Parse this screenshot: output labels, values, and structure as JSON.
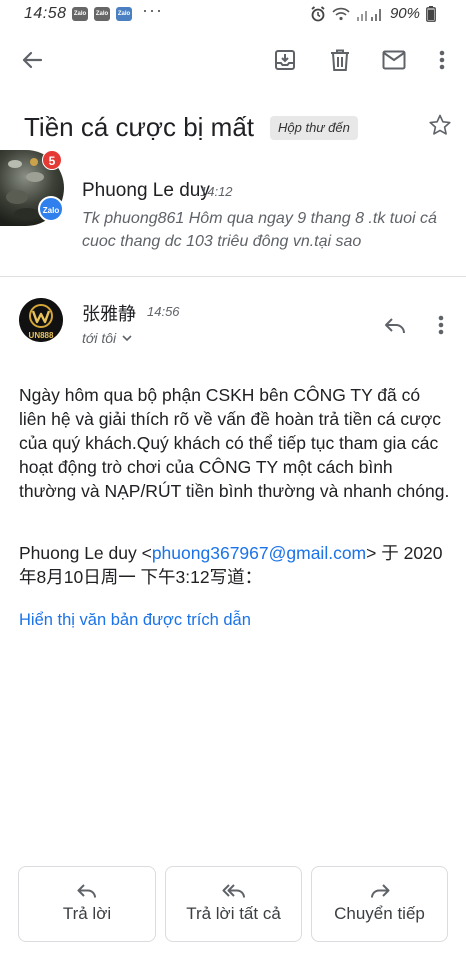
{
  "status_bar": {
    "time": "14:58",
    "app_icons": [
      "Zalo",
      "Zalo",
      "Zalo"
    ],
    "more": "···",
    "battery": "90%"
  },
  "toolbar": {
    "icons": [
      "back-arrow-icon",
      "archive-icon",
      "delete-icon",
      "mark-unread-icon",
      "more-vert-icon"
    ]
  },
  "thread": {
    "subject": "Tiền cá cược bị mất",
    "label": "Hộp thư đến"
  },
  "collapsed_message": {
    "sender": "Phuong Le duy",
    "time": "14:12",
    "badge_count": "5",
    "badge_app": "Zalo",
    "snippet": "Tk phuong861 Hôm qua ngay 9 thang 8 .tk tuoi cá cuoc thang dc 103 triêu đông vn.tại sao"
  },
  "open_message": {
    "sender": "张雅静",
    "time": "14:56",
    "recipient": "tới tôi",
    "avatar_text": "UN888",
    "body": "Ngày hôm qua bộ phận CSKH bên CÔNG TY đã có liên hệ và giải thích rõ về vấn đề hoàn trả tiền cá cược của quý khách.Quý khách có thể tiếp tục tham gia các hoạt động trò chơi của CÔNG TY một cách bình thường và NẠP/RÚT tiền bình thường và nhanh chóng.",
    "quote_prefix": "Phuong Le duy <",
    "quote_email": "phuong367967@gmail.com",
    "quote_suffix": "> 于 2020年8月10日周一 下午3:12写道：",
    "show_quoted": "Hiển thị văn bản được trích dẫn"
  },
  "actions": {
    "reply": "Trả lời",
    "reply_all": "Trả lời tất cả",
    "forward": "Chuyển tiếp"
  },
  "colors": {
    "link": "#1a73e8",
    "badge": "#e53935",
    "zalo": "#2f80ed",
    "chip": "#e8e8e8"
  }
}
